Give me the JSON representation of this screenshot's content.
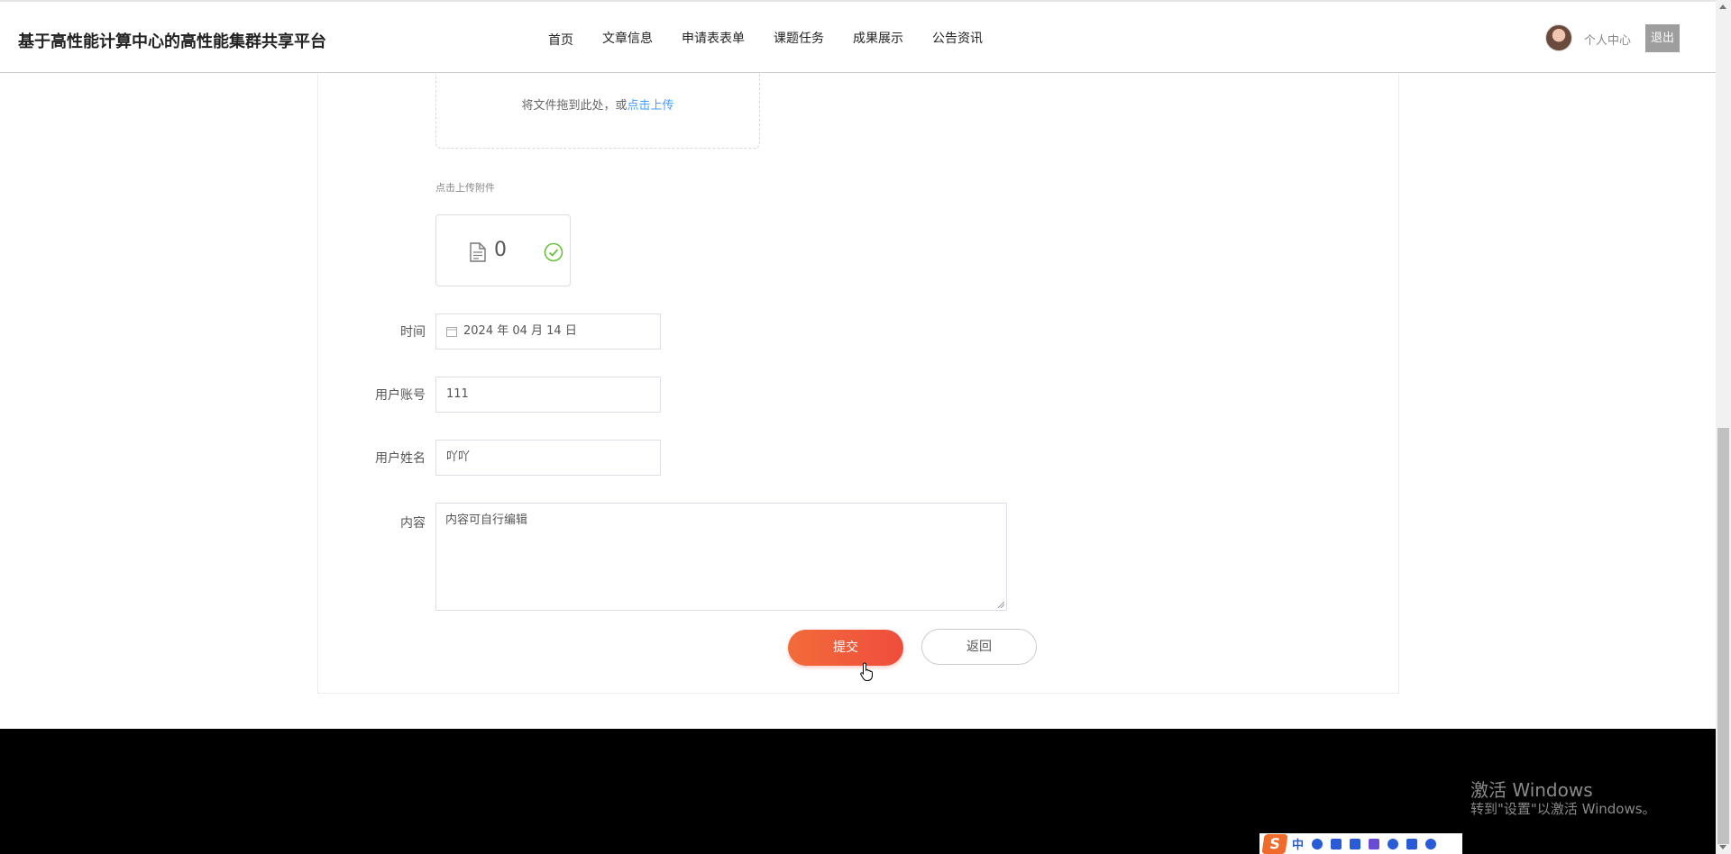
{
  "header": {
    "site_title": "基于高性能计算中心的高性能集群共享平台",
    "nav": [
      "首页",
      "文章信息",
      "申请表表单",
      "课题任务",
      "成果展示",
      "公告资讯"
    ],
    "personal_center": "个人中心",
    "logout": "退出"
  },
  "upload": {
    "drop_text": "将文件拖到此处，或",
    "drop_link": "点击上传",
    "hint": "点击上传附件",
    "file_count": "0"
  },
  "form": {
    "time_label": "时间",
    "time_value": "2024 年 04 月 14 日",
    "account_label": "用户账号",
    "account_value": "111",
    "name_label": "用户姓名",
    "name_value": "吖吖",
    "content_label": "内容",
    "content_value": "内容可自行编辑"
  },
  "buttons": {
    "submit": "提交",
    "back": "返回"
  },
  "watermark": {
    "title": "激活 Windows",
    "subtitle": "转到\"设置\"以激活 Windows。"
  },
  "ime": {
    "logo": "S",
    "mode": "中"
  },
  "colors": {
    "accent": "#ef4d3c",
    "link": "#409eff",
    "success": "#67c23a",
    "footer": "#000000"
  },
  "icons": [
    "file-icon",
    "check-circle-icon",
    "calendar-icon",
    "pointer-cursor-icon"
  ]
}
